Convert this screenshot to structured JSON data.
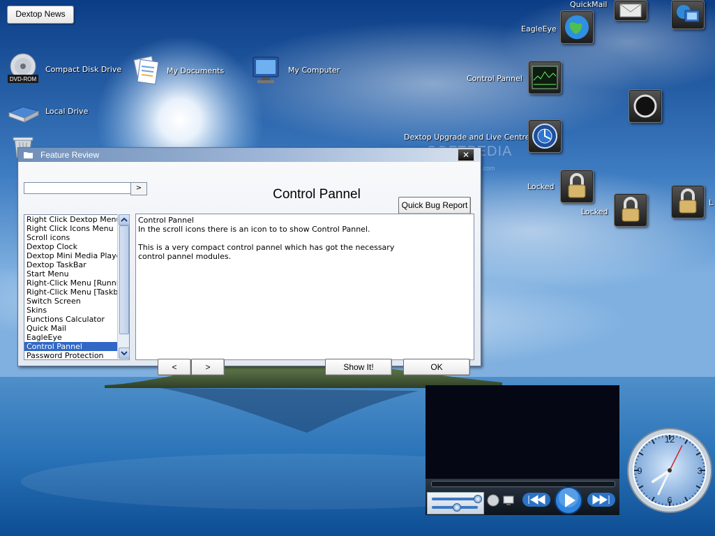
{
  "desktop": {
    "news_button": "Dextop News",
    "icons": {
      "cd": "Compact Disk Drive",
      "cd_badge": "DVD-ROM",
      "documents": "My Documents",
      "computer": "My Computer",
      "local": "Local Drive",
      "quickmail": "QuickMail",
      "eagleeye": "EagleEye",
      "control": "Control Pannel",
      "upgrade": "Dextop Upgrade and Live Centre",
      "locked_1": "Locked",
      "locked_2": "Locked",
      "locked_3": "L"
    }
  },
  "window": {
    "title": "Feature Review",
    "close": "✕",
    "heading": "Control Pannel",
    "search_value": "",
    "go": ">",
    "bug_report": "Quick Bug Report",
    "features": [
      "Right Click Dextop Menu",
      "Right Click Icons Menu",
      "Scroll icons",
      "Dextop Clock",
      "Dextop Mini Media Player",
      "Dextop TaskBar",
      "Start Menu",
      "Right-Click Menu [Running",
      "Right-Click Menu [Taskbar",
      "Switch Screen",
      "Skins",
      "Functions Calculator",
      "Quick Mail",
      "EagleEye",
      "Control Pannel",
      "Password Protection"
    ],
    "selected": "Control Pannel",
    "description": {
      "line1": "Control Pannel",
      "line2": "In the scroll icons there is an icon to to show Control Pannel.",
      "line3": "This is a very compact control pannel which has got the necessary",
      "line4": "control pannel modules."
    },
    "prev": "<",
    "next": ">",
    "show": "Show It!",
    "ok": "OK"
  },
  "player": {
    "seek_progress": 0.0
  },
  "clock": {
    "numbers": [
      "12",
      "3",
      "6",
      "9"
    ]
  },
  "watermark": {
    "text": "SOFTPEDIA",
    "sub": "www.softpedia.com"
  },
  "colors": {
    "selection": "#3168c6",
    "window_border": "#5c7190"
  }
}
